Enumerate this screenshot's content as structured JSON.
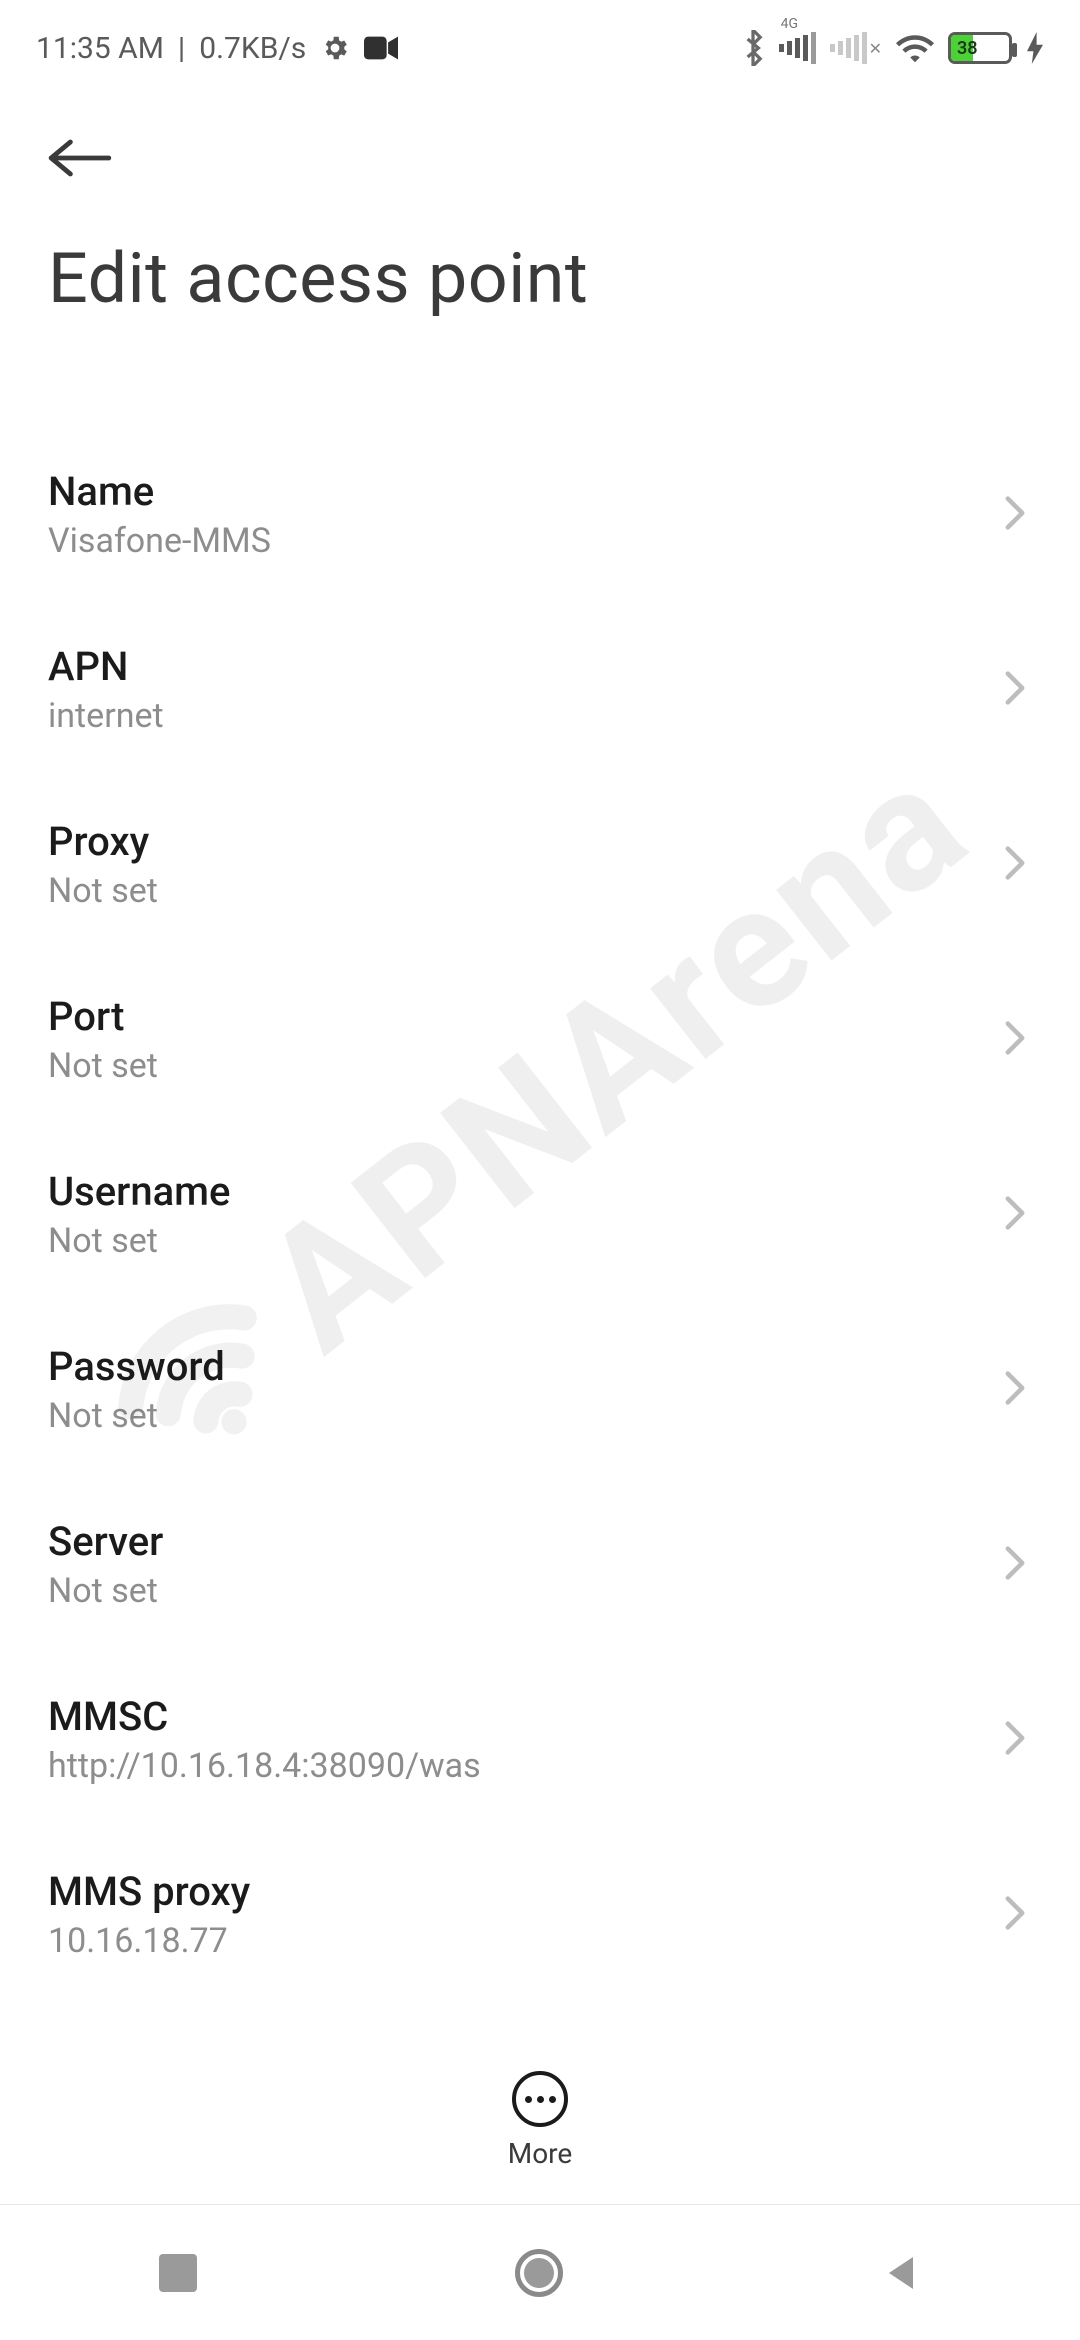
{
  "status": {
    "time": "11:35 AM",
    "sep": "|",
    "netspeed": "0.7KB/s",
    "signal4g_label": "4G",
    "battery_pct": "38"
  },
  "header": {
    "title": "Edit access point"
  },
  "rows": [
    {
      "label": "Name",
      "value": "Visafone-MMS"
    },
    {
      "label": "APN",
      "value": "internet"
    },
    {
      "label": "Proxy",
      "value": "Not set"
    },
    {
      "label": "Port",
      "value": "Not set"
    },
    {
      "label": "Username",
      "value": "Not set"
    },
    {
      "label": "Password",
      "value": "Not set"
    },
    {
      "label": "Server",
      "value": "Not set"
    },
    {
      "label": "MMSC",
      "value": "http://10.16.18.4:38090/was"
    },
    {
      "label": "MMS proxy",
      "value": "10.16.18.77"
    }
  ],
  "more_label": "More",
  "watermark": "APNArena"
}
